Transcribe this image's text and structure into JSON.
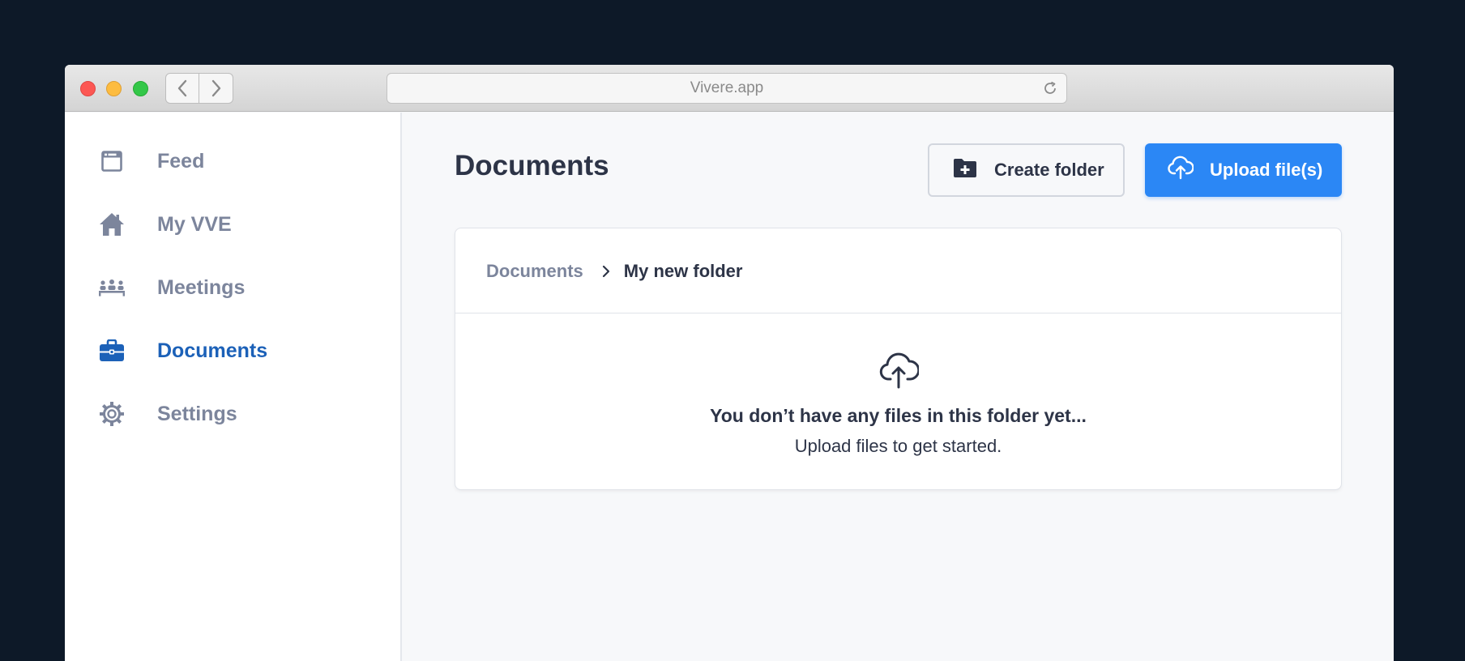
{
  "browser": {
    "url": "Vivere.app",
    "icons": {
      "back": "chevron-left-icon",
      "forward": "chevron-right-icon",
      "reload": "reload-icon"
    }
  },
  "sidebar": {
    "items": [
      {
        "label": "Feed",
        "icon": "feed-icon",
        "active": false
      },
      {
        "label": "My VVE",
        "icon": "home-icon",
        "active": false
      },
      {
        "label": "Meetings",
        "icon": "meetings-icon",
        "active": false
      },
      {
        "label": "Documents",
        "icon": "briefcase-icon",
        "active": true
      },
      {
        "label": "Settings",
        "icon": "gear-icon",
        "active": false
      }
    ]
  },
  "main": {
    "title": "Documents",
    "actions": {
      "create_folder": {
        "label": "Create folder",
        "icon": "folder-plus-icon"
      },
      "upload": {
        "label": "Upload file(s)",
        "icon": "cloud-upload-icon"
      }
    },
    "breadcrumb": {
      "root": "Documents",
      "current": "My new folder"
    },
    "empty_state": {
      "icon": "cloud-upload-icon",
      "title": "You don’t have any files in this folder yet...",
      "subtitle": "Upload files to get started."
    }
  },
  "colors": {
    "accent": "#2b87f5",
    "active_nav": "#1c61b8",
    "muted_text": "#7c859c",
    "dark_text": "#2d3447",
    "outer_background": "#0d1928"
  }
}
